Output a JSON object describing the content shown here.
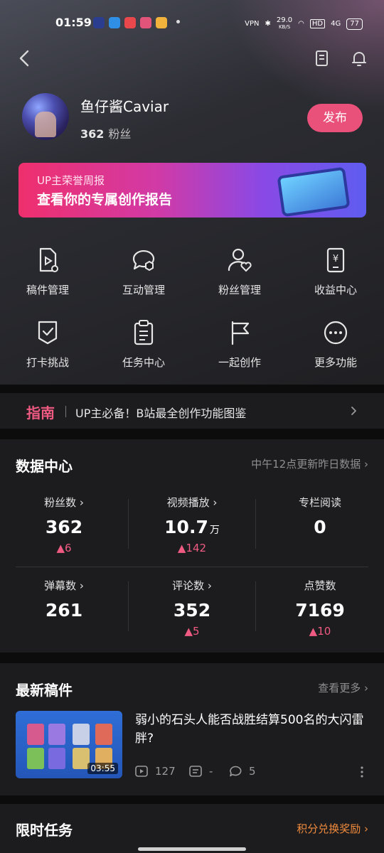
{
  "status_bar": {
    "time": "01:59",
    "network_speed": "29.0",
    "network_unit": "KB/S",
    "vpn": "VPN",
    "hd": "HD",
    "signal": "4G",
    "battery": "77"
  },
  "profile": {
    "username": "鱼仔酱Caviar",
    "fans_count": "362",
    "fans_label": "粉丝",
    "publish_label": "发布"
  },
  "banner": {
    "subtitle": "UP主荣誉周报",
    "title": "查看你的专属创作报告"
  },
  "tools": [
    {
      "label": "稿件管理",
      "icon": "manuscript-icon"
    },
    {
      "label": "互动管理",
      "icon": "interaction-icon"
    },
    {
      "label": "粉丝管理",
      "icon": "fans-icon"
    },
    {
      "label": "收益中心",
      "icon": "income-icon"
    },
    {
      "label": "打卡挑战",
      "icon": "checkin-icon"
    },
    {
      "label": "任务中心",
      "icon": "task-icon"
    },
    {
      "label": "一起创作",
      "icon": "flag-icon"
    },
    {
      "label": "更多功能",
      "icon": "more-icon"
    }
  ],
  "guide": {
    "tag": "指南",
    "text": "UP主必备！B站最全创作功能图鉴"
  },
  "data_center": {
    "title": "数据中心",
    "update_note": "中午12点更新昨日数据",
    "stats": [
      {
        "label": "粉丝数",
        "value": "362",
        "unit": "",
        "delta": "6"
      },
      {
        "label": "视频播放",
        "value": "10.7",
        "unit": "万",
        "delta": "142"
      },
      {
        "label": "专栏阅读",
        "value": "0",
        "unit": "",
        "delta": ""
      },
      {
        "label": "弹幕数",
        "value": "261",
        "unit": "",
        "delta": ""
      },
      {
        "label": "评论数",
        "value": "352",
        "unit": "",
        "delta": "5"
      },
      {
        "label": "点赞数",
        "value": "7169",
        "unit": "",
        "delta": "10"
      }
    ]
  },
  "latest": {
    "title": "最新稿件",
    "more": "查看更多",
    "post": {
      "title": "弱小的石头人能否战胜结算500名的大闪雷胖?",
      "duration": "03:55",
      "plays": "127",
      "danmaku": "-",
      "comments": "5"
    }
  },
  "tasks": {
    "title": "限时任务",
    "link": "积分兑换奖励"
  },
  "colors": {
    "accent_pink": "#e9507a",
    "accent_orange": "#f08a3c"
  }
}
